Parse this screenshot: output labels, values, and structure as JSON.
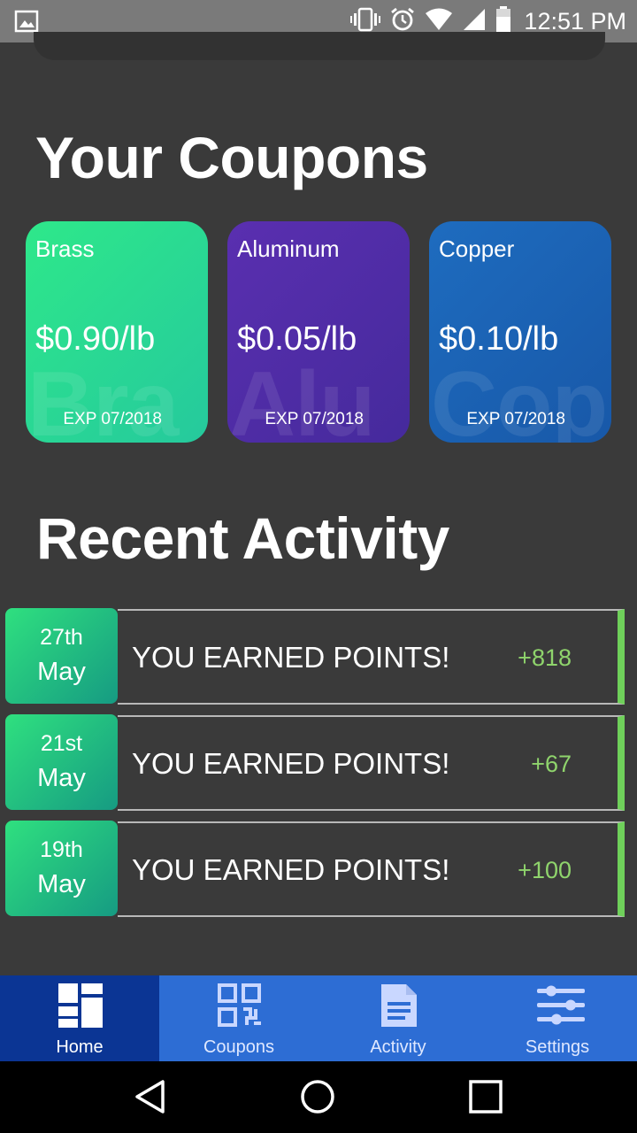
{
  "status_bar": {
    "time": "12:51 PM",
    "icons": [
      "image-icon",
      "vibrate-icon",
      "alarm-icon",
      "wifi-icon",
      "signal-icon",
      "battery-icon"
    ]
  },
  "coupons_section": {
    "title": "Your Coupons",
    "coupons": [
      {
        "name": "Brass",
        "price": "$0.90/lb",
        "watermark": "Bra",
        "exp": "EXP 07/2018",
        "color_from": "#2ee88a",
        "color_to": "#25c99d"
      },
      {
        "name": "Aluminum",
        "price": "$0.05/lb",
        "watermark": "Alu",
        "exp": "EXP 07/2018",
        "color_from": "#5a2fb0",
        "color_to": "#452a9c"
      },
      {
        "name": "Copper",
        "price": "$0.10/lb",
        "watermark": "Cop",
        "exp": "EXP 07/2018",
        "color_from": "#1e6cbf",
        "color_to": "#1858a8"
      }
    ]
  },
  "activity_section": {
    "title": "Recent Activity",
    "items": [
      {
        "day": "27th",
        "month": "May",
        "text": "YOU EARNED POINTS!",
        "points": "+818"
      },
      {
        "day": "21st",
        "month": "May",
        "text": "YOU EARNED POINTS!",
        "points": "+67"
      },
      {
        "day": "19th",
        "month": "May",
        "text": "YOU EARNED POINTS!",
        "points": "+100"
      }
    ]
  },
  "bottom_nav": {
    "items": [
      {
        "label": "Home",
        "icon": "home-grid-icon",
        "active": true
      },
      {
        "label": "Coupons",
        "icon": "qr-code-icon",
        "active": false
      },
      {
        "label": "Activity",
        "icon": "document-icon",
        "active": false
      },
      {
        "label": "Settings",
        "icon": "sliders-icon",
        "active": false
      }
    ]
  },
  "colors": {
    "background": "#3a3a3a",
    "nav_bar": "#2d6dd4",
    "nav_active": "#0b3594",
    "points": "#8fd46c",
    "accent_bar": "#6fd05a"
  }
}
